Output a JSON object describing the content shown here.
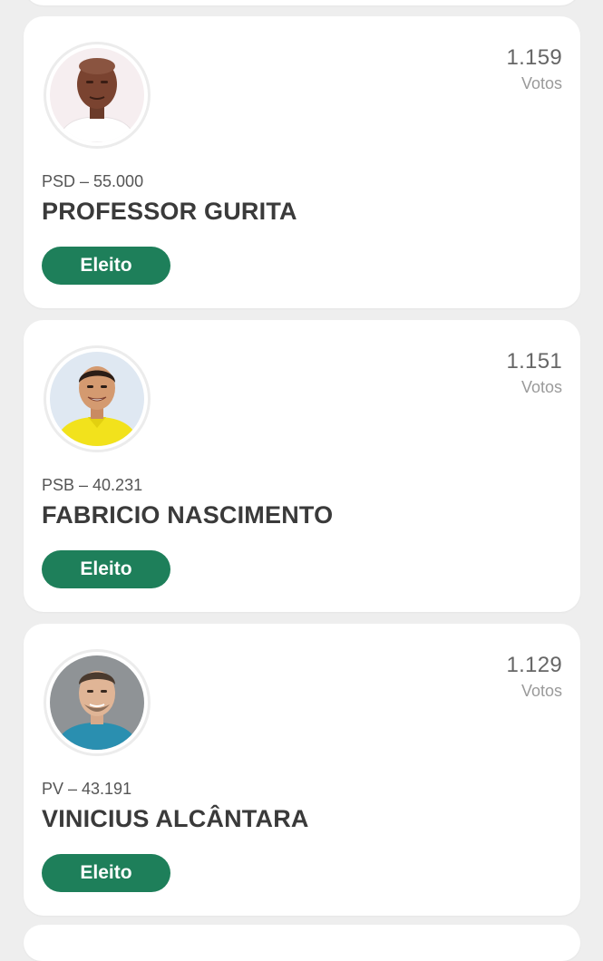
{
  "colors": {
    "background": "#eeeeee",
    "card": "#ffffff",
    "status_badge": "#1e7f5a",
    "name_text": "#3a3a3a",
    "votes_text": "#666666"
  },
  "candidates": [
    {
      "votes": "1.159",
      "votes_label": "Votos",
      "party": "PSD – 55.000",
      "name": "PROFESSOR GURITA",
      "status": "Eleito",
      "photo_icon": "candidate-photo-icon"
    },
    {
      "votes": "1.151",
      "votes_label": "Votos",
      "party": "PSB – 40.231",
      "name": "FABRICIO NASCIMENTO",
      "status": "Eleito",
      "photo_icon": "candidate-photo-icon"
    },
    {
      "votes": "1.129",
      "votes_label": "Votos",
      "party": "PV – 43.191",
      "name": "VINICIUS ALCÂNTARA",
      "status": "Eleito",
      "photo_icon": "candidate-photo-icon"
    }
  ]
}
